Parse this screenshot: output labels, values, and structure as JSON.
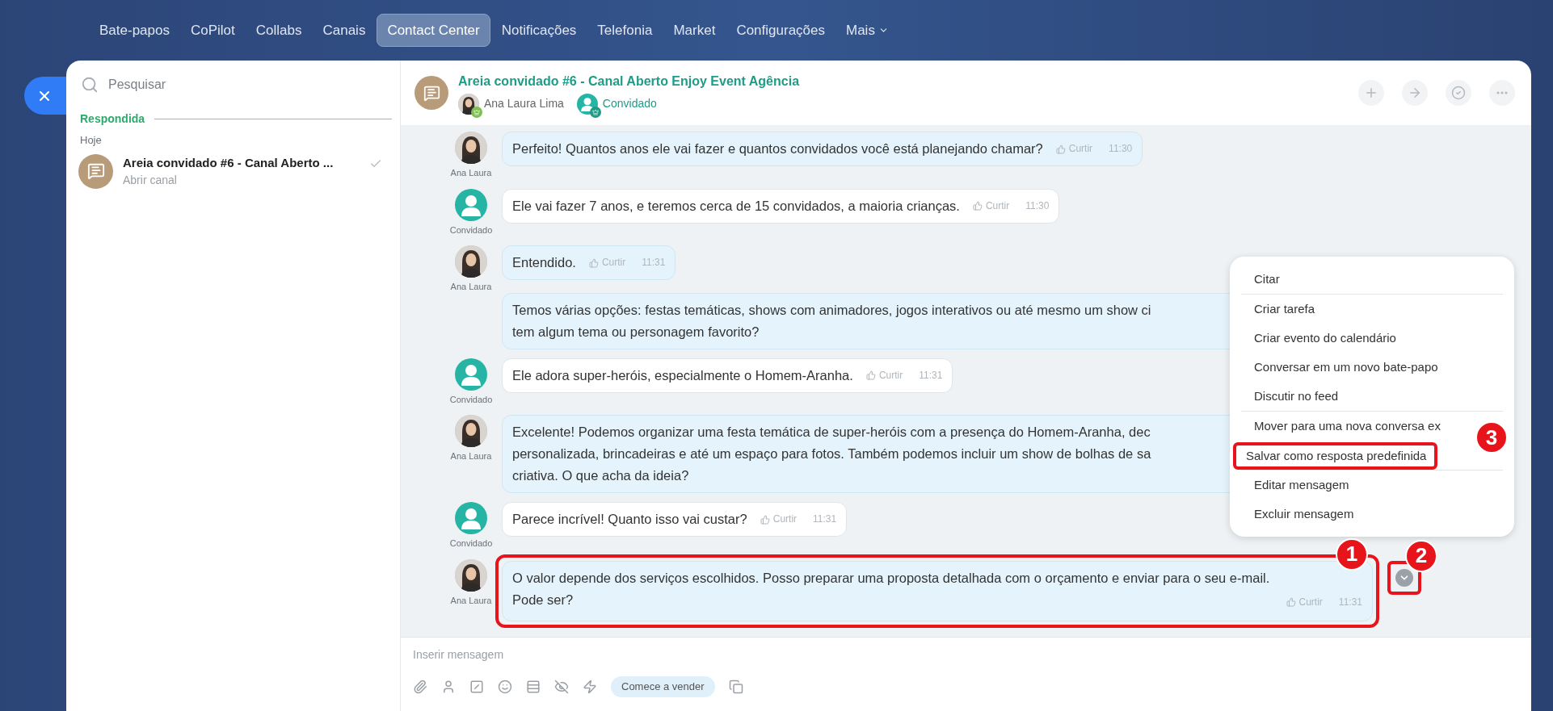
{
  "nav": {
    "items": [
      {
        "label": "Bate-papos",
        "selected": false
      },
      {
        "label": "CoPilot",
        "selected": false
      },
      {
        "label": "Collabs",
        "selected": false
      },
      {
        "label": "Canais",
        "selected": false
      },
      {
        "label": "Contact Center",
        "selected": true
      },
      {
        "label": "Notificações",
        "selected": false
      },
      {
        "label": "Telefonia",
        "selected": false
      },
      {
        "label": "Market",
        "selected": false
      },
      {
        "label": "Configurações",
        "selected": false
      }
    ],
    "more": "Mais"
  },
  "sidebar": {
    "search_placeholder": "Pesquisar",
    "section": "Respondida",
    "group": "Hoje",
    "chats": [
      {
        "title": "Areia convidado #6 - Canal Aberto ...",
        "subtitle": "Abrir canal",
        "read": true
      }
    ]
  },
  "chat": {
    "title": "Areia convidado #6 - Canal Aberto Enjoy Event Agência",
    "members": [
      {
        "name": "Ana Laura Lima",
        "kind": "operator"
      },
      {
        "name": "Convidado",
        "kind": "guest"
      }
    ],
    "messages": [
      {
        "kind": "operator",
        "author": "Ana Laura",
        "lines": [
          "Perfeito! Quantos anos ele vai fazer e quantos convidados você está planejando chamar?"
        ],
        "like": "Curtir",
        "time": "11:30"
      },
      {
        "kind": "guest",
        "author": "Convidado",
        "lines": [
          "Ele vai fazer 7 anos, e teremos cerca de 15 convidados, a maioria crianças."
        ],
        "like": "Curtir",
        "time": "11:30"
      },
      {
        "kind": "operator",
        "author": "Ana Laura",
        "lines": [
          "Entendido."
        ],
        "like": "Curtir",
        "time": "11:31"
      },
      {
        "kind": "operator",
        "lines": [
          "Temos várias opções: festas temáticas, shows com animadores, jogos interativos ou até mesmo um show ci",
          "tem algum tema ou personagem favorito?"
        ]
      },
      {
        "kind": "guest",
        "author": "Convidado",
        "lines": [
          "Ele adora super-heróis, especialmente o Homem-Aranha."
        ],
        "like": "Curtir",
        "time": "11:31"
      },
      {
        "kind": "operator",
        "author": "Ana Laura",
        "lines": [
          "Excelente! Podemos organizar uma festa temática de super-heróis com a presença do Homem-Aranha, dec",
          "personalizada, brincadeiras e até um espaço para fotos. Também podemos incluir um show de bolhas de sa",
          "criativa. O que acha da ideia?"
        ]
      },
      {
        "kind": "guest",
        "author": "Convidado",
        "lines": [
          "Parece incrível! Quanto isso vai custar?"
        ],
        "like": "Curtir",
        "time": "11:31"
      },
      {
        "kind": "operator",
        "author": "Ana Laura",
        "lines": [
          "O valor depende dos serviços escolhidos. Posso preparar uma proposta detalhada com o orçamento e enviar para o seu e-mail.",
          "Pode ser?"
        ],
        "like": "Curtir",
        "time": "11:31",
        "marker": "1",
        "menu_marker": "2"
      }
    ],
    "input_placeholder": "Inserir mensagem",
    "sell_button": "Comece a vender"
  },
  "context_menu": {
    "groups": [
      [
        {
          "label": "Citar"
        }
      ],
      [
        {
          "label": "Criar tarefa"
        },
        {
          "label": "Criar evento do calendário"
        },
        {
          "label": "Conversar em um novo bate-papo"
        },
        {
          "label": "Discutir no feed"
        }
      ],
      [
        {
          "label": "Mover para uma nova conversa ex"
        },
        {
          "label": "Salvar como resposta predefinida",
          "marker": "3"
        }
      ],
      [
        {
          "label": "Editar mensagem"
        },
        {
          "label": "Excluir mensagem"
        }
      ]
    ]
  }
}
